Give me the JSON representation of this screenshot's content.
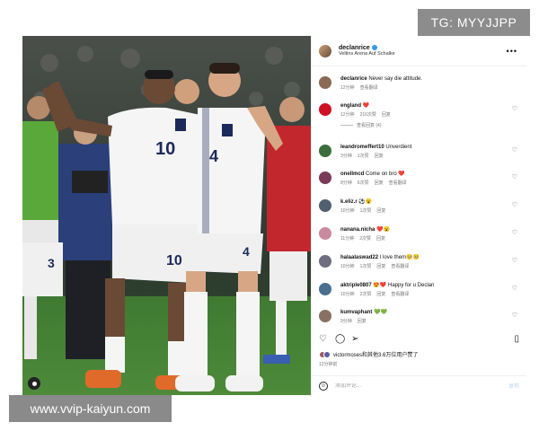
{
  "overlay": {
    "tg_badge": "TG: MYYJJPP",
    "watermark": "www.vvip-kaiyun.com"
  },
  "post": {
    "author": "declanrice",
    "location": "Veltins Arena Auf Schalke",
    "more_icon": "more-horizontal-icon",
    "player_numbers": [
      "10",
      "4",
      "10",
      "4",
      "3"
    ]
  },
  "comments": [
    {
      "user": "declanrice",
      "text": "Never say die attitude.",
      "time": "12分钟",
      "likes": "",
      "reply": "",
      "translate": "查看翻译",
      "avatar_color": "#8a6a55"
    },
    {
      "user": "england",
      "text": "❤️",
      "time": "12分钟",
      "likes": "216次赞",
      "reply": "回复",
      "translate": "",
      "view_replies": "查看回复 (4)",
      "avatar_color": "#ce1124"
    },
    {
      "user": "leandromeffert10",
      "text": "Unverdient",
      "time": "3分钟",
      "likes": "1次赞",
      "reply": "回复",
      "translate": "",
      "avatar_color": "#3b6e3b"
    },
    {
      "user": "onellmcd",
      "text": "Come on bro ❤️",
      "time": "8分钟",
      "likes": "6次赞",
      "reply": "回复",
      "translate": "查看翻译",
      "avatar_color": "#7a3a5a"
    },
    {
      "user": "k.eliz.r",
      "text": "⚽😮",
      "time": "10分钟",
      "likes": "1次赞",
      "reply": "回复",
      "translate": "",
      "avatar_color": "#506070"
    },
    {
      "user": "nanana.nicha",
      "text": "❤️😮",
      "time": "11分钟",
      "likes": "2次赞",
      "reply": "回复",
      "translate": "",
      "avatar_color": "#c98aa0"
    },
    {
      "user": "halaalaswad22",
      "text": "I love them🥺🥺",
      "time": "10分钟",
      "likes": "1次赞",
      "reply": "回复",
      "translate": "查看翻译",
      "avatar_color": "#6e6e80"
    },
    {
      "user": "aktriple0807",
      "text": "😍❤️ Happy for u Declan",
      "time": "10分钟",
      "likes": "2次赞",
      "reply": "回复",
      "translate": "查看翻译",
      "avatar_color": "#4a7090"
    },
    {
      "user": "kumvaphant",
      "text": "💚💚",
      "time": "9分钟",
      "likes": "",
      "reply": "回复",
      "translate": "",
      "avatar_color": "#8a7060"
    }
  ],
  "actions": {
    "like_icon": "heart-icon",
    "comment_icon": "comment-icon",
    "share_icon": "send-icon",
    "save_icon": "bookmark-icon",
    "likes_text": "victormoses和其他3.6万位用户赞了",
    "time_ago": "12分钟前"
  },
  "comment_box": {
    "placeholder": "添加评论...",
    "post_label": "发布"
  }
}
